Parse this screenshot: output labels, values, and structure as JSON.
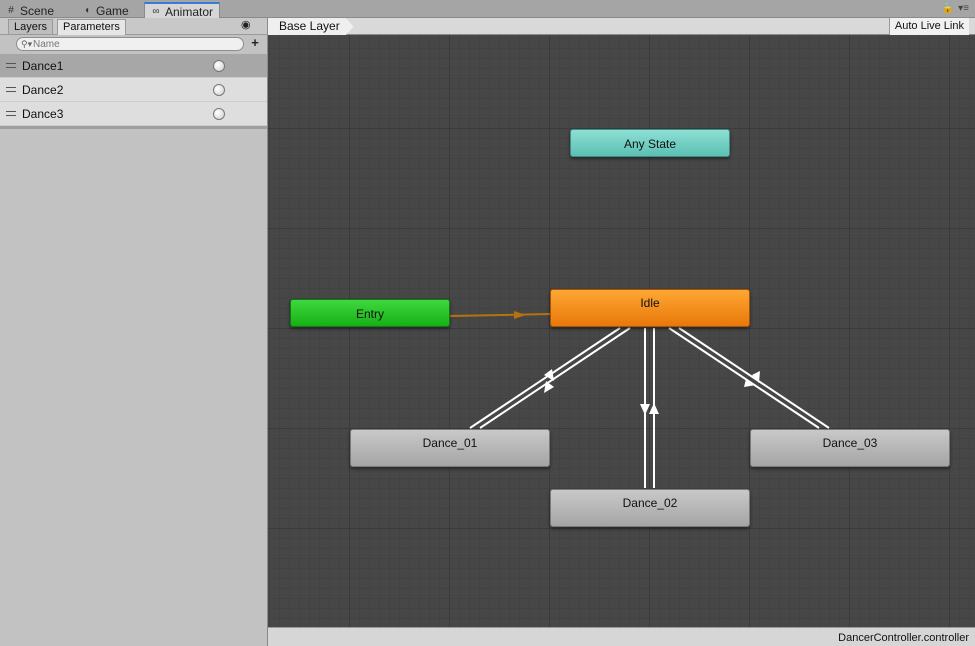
{
  "window_tabs": [
    {
      "label": "Scene",
      "icon": "grid-icon"
    },
    {
      "label": "Game",
      "icon": "pacman-icon"
    },
    {
      "label": "Animator",
      "icon": "animator-icon",
      "active": true
    }
  ],
  "left_panel": {
    "tabs": [
      "Layers",
      "Parameters"
    ],
    "active_tab": "Parameters",
    "search": {
      "placeholder": "Name",
      "value": ""
    },
    "parameters": [
      {
        "name": "Dance1",
        "type": "trigger",
        "selected": true
      },
      {
        "name": "Dance2",
        "type": "trigger",
        "selected": false
      },
      {
        "name": "Dance3",
        "type": "trigger",
        "selected": false
      }
    ]
  },
  "graph": {
    "breadcrumb": "Base Layer",
    "live_link_label": "Auto Live Link",
    "states": {
      "any": "Any State",
      "entry": "Entry",
      "idle": "Idle",
      "dance_01": "Dance_01",
      "dance_02": "Dance_02",
      "dance_03": "Dance_03"
    },
    "colors": {
      "any_state": "#6fcfc3",
      "entry": "#22c022",
      "default_state": "#f58a1c",
      "state": "#b5b5b5",
      "entry_transition": "#b5720e",
      "transition": "#ffffff"
    }
  },
  "status_bar": {
    "file": "DancerController.controller"
  }
}
